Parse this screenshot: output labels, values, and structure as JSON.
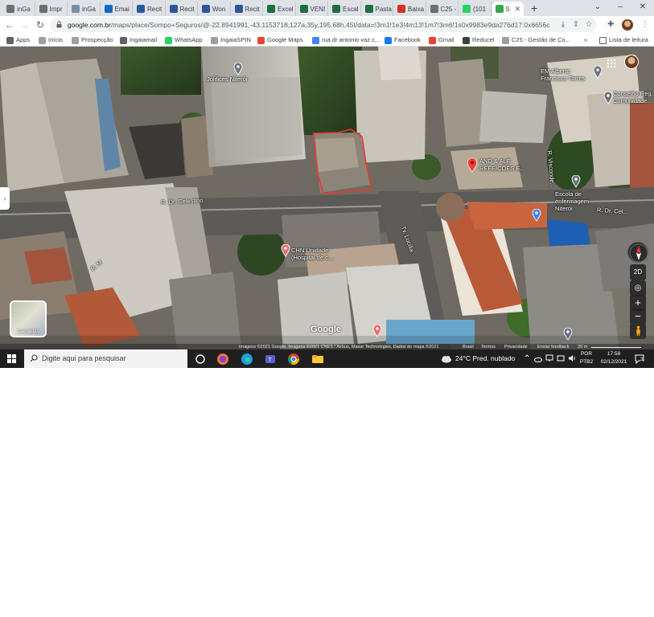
{
  "browser": {
    "tabs": [
      {
        "label": "inGa",
        "color": "#6e6e6e"
      },
      {
        "label": "Impr",
        "color": "#6e6e6e"
      },
      {
        "label": "inGa",
        "color": "#7a8da6"
      },
      {
        "label": "Emai",
        "color": "#0f6cbd"
      },
      {
        "label": "Recit",
        "color": "#2b579a"
      },
      {
        "label": "Recit",
        "color": "#2b579a"
      },
      {
        "label": "Won",
        "color": "#2b579a"
      },
      {
        "label": "Recit",
        "color": "#2b579a"
      },
      {
        "label": "Excel",
        "color": "#1d6f42"
      },
      {
        "label": "VENI",
        "color": "#1d6f42"
      },
      {
        "label": "Escal",
        "color": "#1d6f42"
      },
      {
        "label": "Pasta",
        "color": "#1d6f42"
      },
      {
        "label": "Baixa",
        "color": "#d93025"
      },
      {
        "label": "C25 -",
        "color": "#6e6e6e"
      },
      {
        "label": "(101",
        "color": "#25d366"
      },
      {
        "label": "S",
        "color": "#34a853",
        "active": true
      }
    ],
    "new_tab": "+",
    "window_controls": {
      "minimize": "–",
      "maximize": "❐",
      "close": "✕",
      "tab_search": "⌄"
    },
    "url_host": "google.com.br",
    "url_rest": "/maps/place/Sompo+Seguros/@-22.8941991,-43.1153718,127a,35y,195.68h,45t/data=!3m1!1e3!4m13!1m7!3m6!1s0x9983e9da276d17:0x6656c330...",
    "bookmarks": [
      {
        "label": "Apps",
        "color": "#5f6368"
      },
      {
        "label": "Início",
        "color": "#9aa0a6"
      },
      {
        "label": "Prospecção",
        "color": "#9aa0a6"
      },
      {
        "label": "Ingaiamail",
        "color": "#5f6368"
      },
      {
        "label": "WhatsApp",
        "color": "#25d366"
      },
      {
        "label": "IngaiaSPIN",
        "color": "#9aa0a6"
      },
      {
        "label": "Google Maps",
        "color": "#ea4335"
      },
      {
        "label": "rua dr antonio vaz c...",
        "color": "#4285f4"
      },
      {
        "label": "Facebook",
        "color": "#1877f2"
      },
      {
        "label": "Gmail",
        "color": "#ea4335"
      },
      {
        "label": "Reducel",
        "color": "#3c4043"
      },
      {
        "label": "C25 - Gestão de Co...",
        "color": "#9aa0a6"
      }
    ],
    "bookmarks_more": "»",
    "reading_list": "Lista de leitura"
  },
  "map": {
    "labels": [
      {
        "text": "Jolifices Niterói",
        "kind": "grey"
      },
      {
        "text": "EM Alberto Francisco Torres",
        "kind": "grey"
      },
      {
        "text": "Conselho Reg. Comunidade...",
        "kind": "grey"
      },
      {
        "text": "AND & ALE REFEIÇÕES E...",
        "kind": "red"
      },
      {
        "text": "Escola de enfermagem Niterói",
        "kind": "grey"
      },
      {
        "text": "R. Dr. Celestino",
        "kind": "street"
      },
      {
        "text": "R. Dr. Cel...",
        "kind": "street"
      },
      {
        "text": "CHN Unidade (Hospital de c...",
        "kind": "red"
      },
      {
        "text": "R. M",
        "kind": "street"
      },
      {
        "text": "Tv. Lucília",
        "kind": "street"
      },
      {
        "text": "R. Visconde...",
        "kind": "street"
      }
    ],
    "controls": {
      "compass": "N",
      "view_2d": "2D",
      "locate": "◎",
      "zoom_in": "+",
      "zoom_out": "−",
      "pegman": "🚶"
    },
    "layers_label": "Camadas",
    "google_logo": "Google",
    "attribution": [
      "Imagens ©2021 Google, Imagens ©2021 CNES / Airbus, Maxar Technologies, Dados do mapa ©2021",
      "Brasil",
      "Termos",
      "Privacidade",
      "Enviar feedback",
      "20 m"
    ],
    "highlight_color": "#e53935"
  },
  "taskbar": {
    "search_placeholder": "Digite aqui para pesquisar",
    "weather": "24°C  Pred. nublado",
    "lang_top": "POR",
    "lang_bottom": "PTB2",
    "time": "17:58",
    "date": "02/12/2021",
    "notification_count": "3"
  }
}
